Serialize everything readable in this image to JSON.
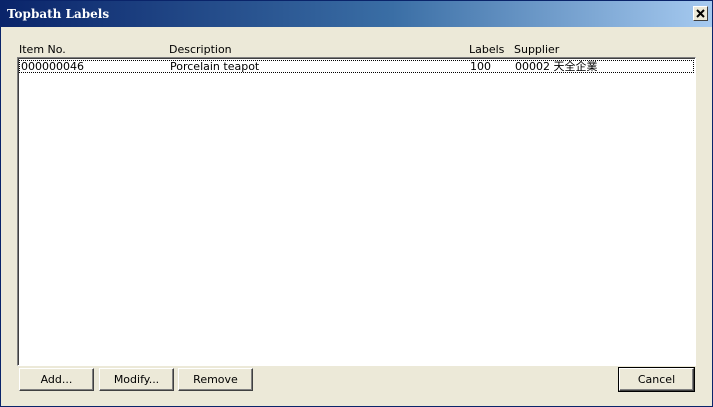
{
  "window": {
    "title": "Topbath Labels",
    "close_glyph": "×"
  },
  "table": {
    "headers": {
      "item_no": "Item No.",
      "description": "Description",
      "labels": "Labels",
      "supplier": "Supplier"
    },
    "rows": [
      {
        "item_no": "000000046",
        "description": "Porcelain teapot",
        "labels": "100",
        "supplier": "00002 天全企業"
      }
    ]
  },
  "buttons": {
    "add": "Add...",
    "modify": "Modify...",
    "remove": "Remove",
    "cancel": "Cancel"
  },
  "icons": {
    "close": "close-icon"
  }
}
